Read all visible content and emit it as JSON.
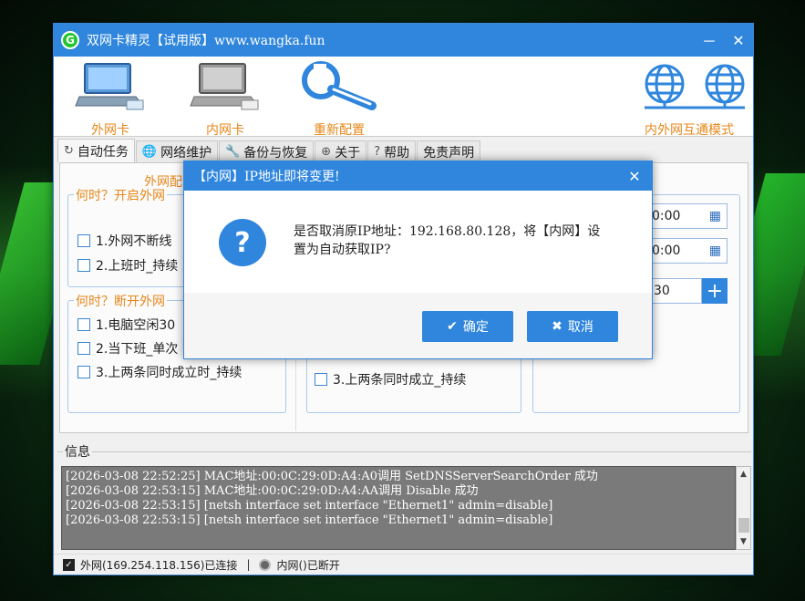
{
  "app": {
    "title": "双网卡精灵【试用版】www.wangka.fun",
    "logo": "G"
  },
  "window_controls": {
    "minimize": "－",
    "close": "✕"
  },
  "toolbar": {
    "outer": "外网卡",
    "inner": "内网卡",
    "reconfig": "重新配置",
    "interconnect": "内外网互通模式"
  },
  "tabs": [
    {
      "label": "自动任务",
      "icon": "refresh-icon"
    },
    {
      "label": "网络维护",
      "icon": "globe-icon"
    },
    {
      "label": "备份与恢复",
      "icon": "wrench-icon"
    },
    {
      "label": "关于",
      "icon": "globe-icon"
    },
    {
      "label": "帮助",
      "icon": "help-icon"
    },
    {
      "label": "免责声明",
      "icon": ""
    }
  ],
  "panel": {
    "outer_section_title": "外网配",
    "group1": {
      "legend": "何时？开启外网",
      "items": [
        "1.外网不断线",
        "2.上班时_持续"
      ]
    },
    "group2": {
      "legend": "何时？断开外网",
      "items": [
        "1.电脑空闲30",
        "2.当下班_单次",
        "3.上两条同时成立时_持续"
      ]
    },
    "mid_group": {
      "items": [
        "3.上两条同时成立_持续"
      ]
    },
    "time1": "0:00",
    "time2": "0:00",
    "minutes": "30",
    "plus": "+"
  },
  "info": {
    "title": "信息",
    "log": [
      "[2026-03-08 22:52:25] MAC地址:00:0C:29:0D:A4:A0调用 SetDNSServerSearchOrder 成功",
      "[2026-03-08 22:53:15] MAC地址:00:0C:29:0D:A4:AA调用 Disable 成功",
      "[2026-03-08 22:53:15] [netsh interface set interface \"Ethernet1\" admin=disable]",
      "[2026-03-08 22:53:15] [netsh interface set interface \"Ethernet1\" admin=disable]"
    ]
  },
  "status": {
    "outer": "外网(169.254.118.156)已连接",
    "separator": "|",
    "inner": "内网()已断开"
  },
  "dialog": {
    "title": "【内网】IP地址即将变更!",
    "message": "是否取消原IP地址：192.168.80.128，将【内网】设置为自动获取IP?",
    "ok": "确定",
    "cancel": "取消",
    "icon": "?"
  },
  "colors": {
    "accent": "#2f86dc",
    "orange": "#e6871b"
  }
}
